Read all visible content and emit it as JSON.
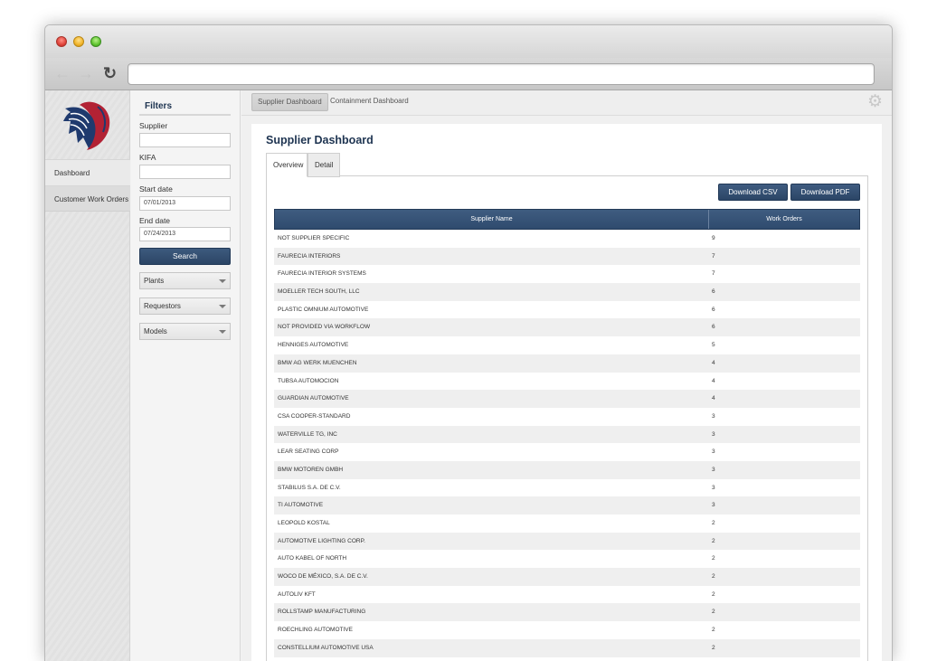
{
  "browser": {
    "url": ""
  },
  "nav": {
    "items": [
      {
        "label": "Dashboard"
      },
      {
        "label": "Customer Work Orders"
      }
    ]
  },
  "filters": {
    "title": "Filters",
    "supplier_label": "Supplier",
    "supplier_value": "",
    "kifa_label": "KIFA",
    "kifa_value": "",
    "start_label": "Start date",
    "start_value": "07/01/2013",
    "end_label": "End date",
    "end_value": "07/24/2013",
    "search_label": "Search",
    "plants_label": "Plants",
    "requestors_label": "Requestors",
    "models_label": "Models"
  },
  "topbar": {
    "tabs": [
      {
        "label": "Supplier Dashboard"
      },
      {
        "label": "Containment Dashboard"
      }
    ]
  },
  "main": {
    "title": "Supplier Dashboard",
    "tabs": [
      {
        "label": "Overview"
      },
      {
        "label": "Detail"
      }
    ],
    "download_csv_label": "Download CSV",
    "download_pdf_label": "Download PDF",
    "table": {
      "columns": [
        "Supplier Name",
        "Work Orders"
      ],
      "rows": [
        {
          "name": "NOT SUPPLIER SPECIFIC",
          "orders": "9"
        },
        {
          "name": "FAURECIA INTERIORS",
          "orders": "7"
        },
        {
          "name": "FAURECIA INTERIOR SYSTEMS",
          "orders": "7"
        },
        {
          "name": "MOELLER TECH SOUTH, LLC",
          "orders": "6"
        },
        {
          "name": "PLASTIC OMNIUM AUTOMOTIVE",
          "orders": "6"
        },
        {
          "name": "NOT PROVIDED VIA WORKFLOW",
          "orders": "6"
        },
        {
          "name": "HENNIGES AUTOMOTIVE",
          "orders": "5"
        },
        {
          "name": "BMW AG WERK MUENCHEN",
          "orders": "4"
        },
        {
          "name": "TUBSA AUTOMOCION",
          "orders": "4"
        },
        {
          "name": "GUARDIAN AUTOMOTIVE",
          "orders": "4"
        },
        {
          "name": "CSA COOPER-STANDARD",
          "orders": "3"
        },
        {
          "name": "WATERVILLE TG, INC",
          "orders": "3"
        },
        {
          "name": "LEAR SEATING CORP",
          "orders": "3"
        },
        {
          "name": "BMW MOTOREN GMBH",
          "orders": "3"
        },
        {
          "name": "STABILUS S.A. DE C.V.",
          "orders": "3"
        },
        {
          "name": "TI AUTOMOTIVE",
          "orders": "3"
        },
        {
          "name": "LEOPOLD KOSTAL",
          "orders": "2"
        },
        {
          "name": "AUTOMOTIVE LIGHTING CORP.",
          "orders": "2"
        },
        {
          "name": "AUTO KABEL OF NORTH",
          "orders": "2"
        },
        {
          "name": "WOCO DE MÉXICO, S.A. DE C.V.",
          "orders": "2"
        },
        {
          "name": "AUTOLIV KFT",
          "orders": "2"
        },
        {
          "name": "ROLLSTAMP MANUFACTURING",
          "orders": "2"
        },
        {
          "name": "ROECHLING AUTOMOTIVE",
          "orders": "2"
        },
        {
          "name": "CONSTELLIUM AUTOMOTIVE USA",
          "orders": "2"
        }
      ]
    }
  },
  "colors": {
    "accent": "#2f4b6e",
    "title": "#1e3451"
  }
}
